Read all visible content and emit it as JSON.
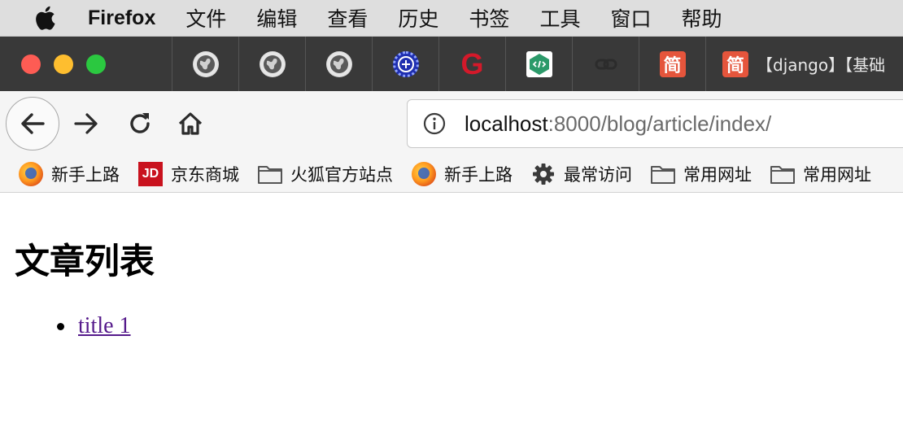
{
  "menubar": {
    "apple_icon": "apple-logo-icon",
    "app_name": "Firefox",
    "items": [
      "文件",
      "编辑",
      "查看",
      "历史",
      "书签",
      "工具",
      "窗口",
      "帮助"
    ]
  },
  "tabs": {
    "traffic_lights": {
      "close": "#fd5c54",
      "minimize": "#febe2f",
      "zoom": "#2bc840"
    },
    "items": [
      {
        "icon": "globe-icon"
      },
      {
        "icon": "globe-icon"
      },
      {
        "icon": "globe-icon"
      },
      {
        "icon": "dotted-blue-favicon-icon"
      },
      {
        "icon": "g-logo-icon",
        "glyph": "G"
      },
      {
        "icon": "code-favicon-icon"
      },
      {
        "icon": "link-icon"
      },
      {
        "icon": "jian-favicon-icon",
        "glyph": "简"
      }
    ],
    "active": {
      "icon": "jian-favicon-icon",
      "glyph": "简",
      "title": "【django】【基础"
    }
  },
  "navbar": {
    "url_host": "localhost",
    "url_rest": ":8000/blog/article/index/"
  },
  "bookmarks": [
    {
      "label": "新手上路",
      "icon": "firefox-icon"
    },
    {
      "label": "京东商城",
      "icon": "jd-icon",
      "glyph": "JD"
    },
    {
      "label": "火狐官方站点",
      "icon": "folder-icon"
    },
    {
      "label": "新手上路",
      "icon": "firefox-icon"
    },
    {
      "label": "最常访问",
      "icon": "gear-icon"
    },
    {
      "label": "常用网址",
      "icon": "folder-icon"
    },
    {
      "label": "常用网址",
      "icon": "folder-icon"
    }
  ],
  "page": {
    "title": "文章列表",
    "articles": [
      {
        "title": "title 1"
      }
    ]
  },
  "colors": {
    "tabstrip_bg": "#393939",
    "visited_link": "#551a8b",
    "jian_red": "#e5553c",
    "g_red": "#d4192a"
  }
}
